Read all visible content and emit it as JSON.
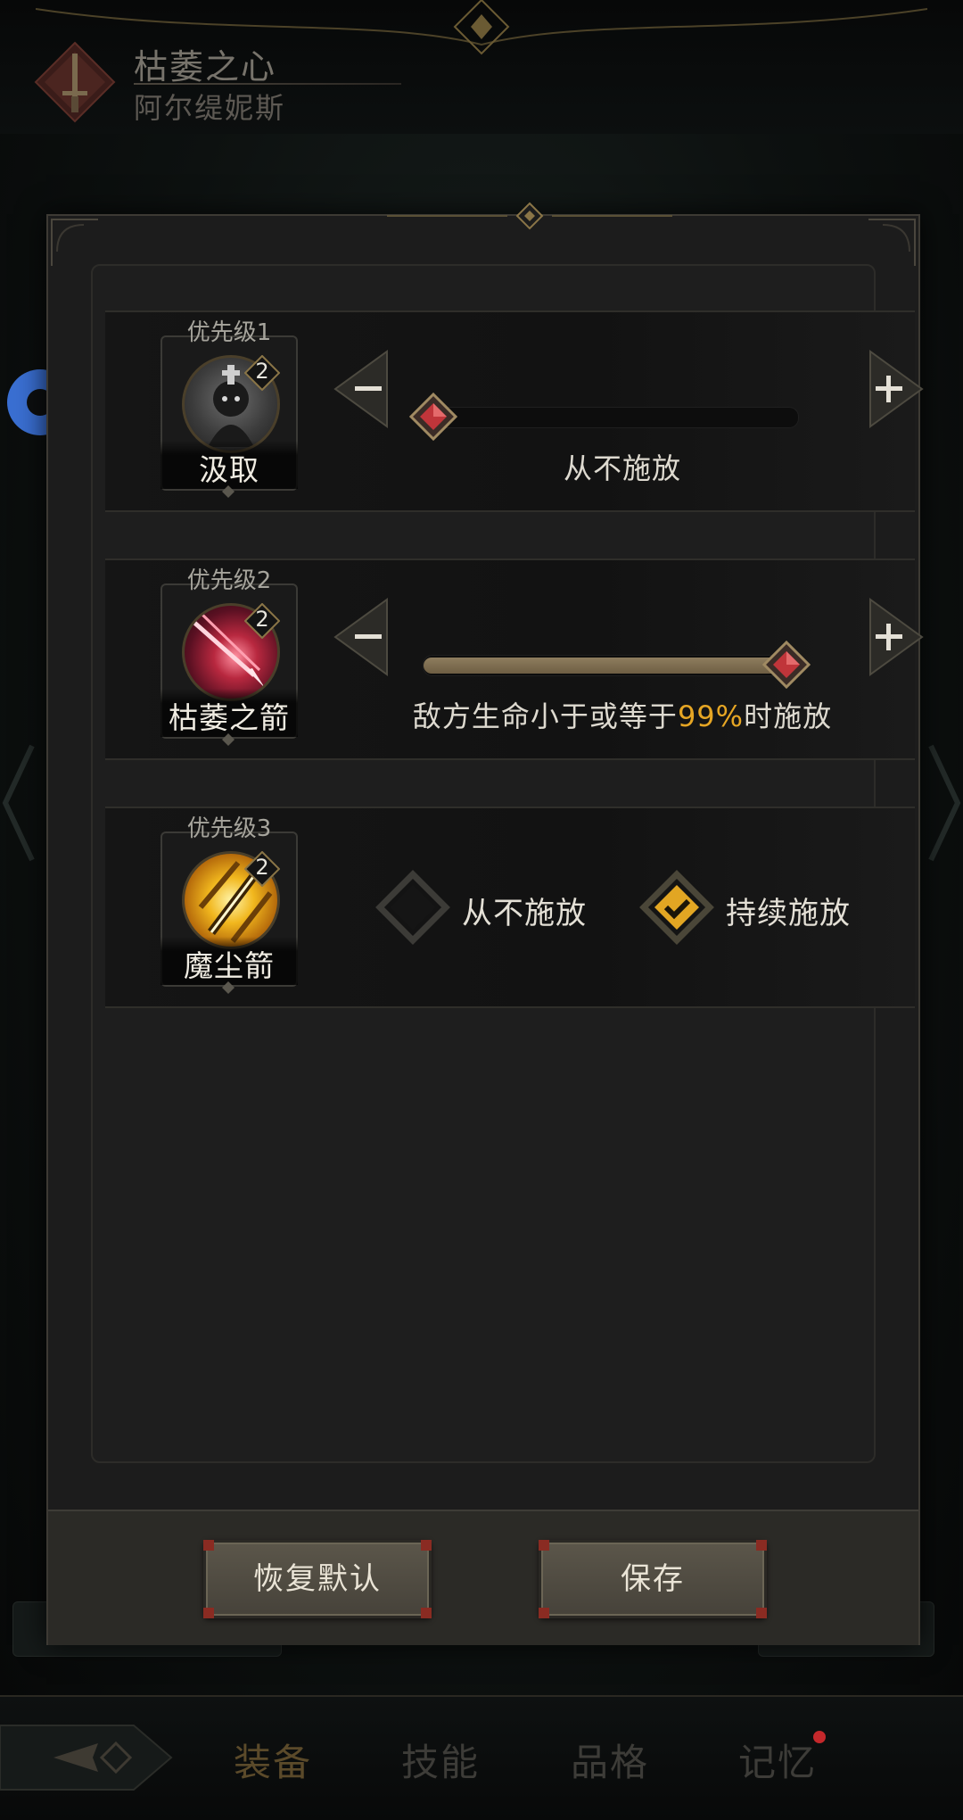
{
  "header": {
    "title": "枯萎之心",
    "subtitle": "阿尔缇妮斯"
  },
  "modal": {
    "skills": [
      {
        "priority_label": "优先级1",
        "level": "2",
        "name": "汲取",
        "control": "slider",
        "slider_fraction": 0.0,
        "caption": "从不施放"
      },
      {
        "priority_label": "优先级2",
        "level": "2",
        "name": "枯萎之箭",
        "control": "slider",
        "slider_fraction": 1.0,
        "caption_prefix": "敌方生命小于或等于",
        "caption_value": "99%",
        "caption_suffix": "时施放"
      },
      {
        "priority_label": "优先级3",
        "level": "2",
        "name": "魔尘箭",
        "control": "options",
        "options": [
          {
            "label": "从不施放",
            "checked": false
          },
          {
            "label": "持续施放",
            "checked": true
          }
        ]
      }
    ],
    "buttons": {
      "reset": "恢复默认",
      "save": "保存"
    }
  },
  "bottom_nav": {
    "items": [
      {
        "label": "装备",
        "active": true
      },
      {
        "label": "技能",
        "active": false
      },
      {
        "label": "品格",
        "active": false
      },
      {
        "label": "记忆",
        "active": false,
        "notification": true
      }
    ]
  },
  "colors": {
    "highlight": "#e6a624",
    "accent_gold": "#c9a45b",
    "thumb_red": "#c0353a",
    "float_button": "#3a6fd2"
  }
}
